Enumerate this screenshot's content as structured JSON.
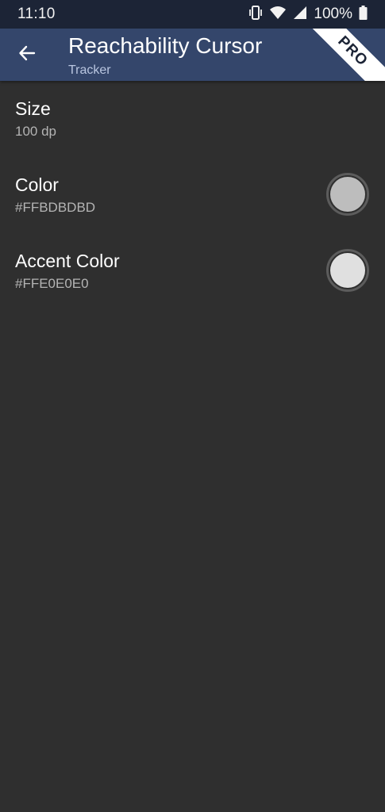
{
  "status_bar": {
    "time": "11:10",
    "battery_percent": "100%",
    "icons": [
      "vibrate-icon",
      "wifi-icon",
      "signal-icon",
      "battery-icon"
    ]
  },
  "app_bar": {
    "title": "Reachability Cursor",
    "subtitle": "Tracker",
    "ribbon": "PRO",
    "colors": {
      "background": "#34466b",
      "status_bar": "#1c2436"
    }
  },
  "settings": [
    {
      "title": "Size",
      "summary": "100 dp"
    },
    {
      "title": "Color",
      "summary": "#FFBDBDBD",
      "swatch": "#BDBDBD"
    },
    {
      "title": "Accent Color",
      "summary": "#FFE0E0E0",
      "swatch": "#E0E0E0"
    }
  ]
}
